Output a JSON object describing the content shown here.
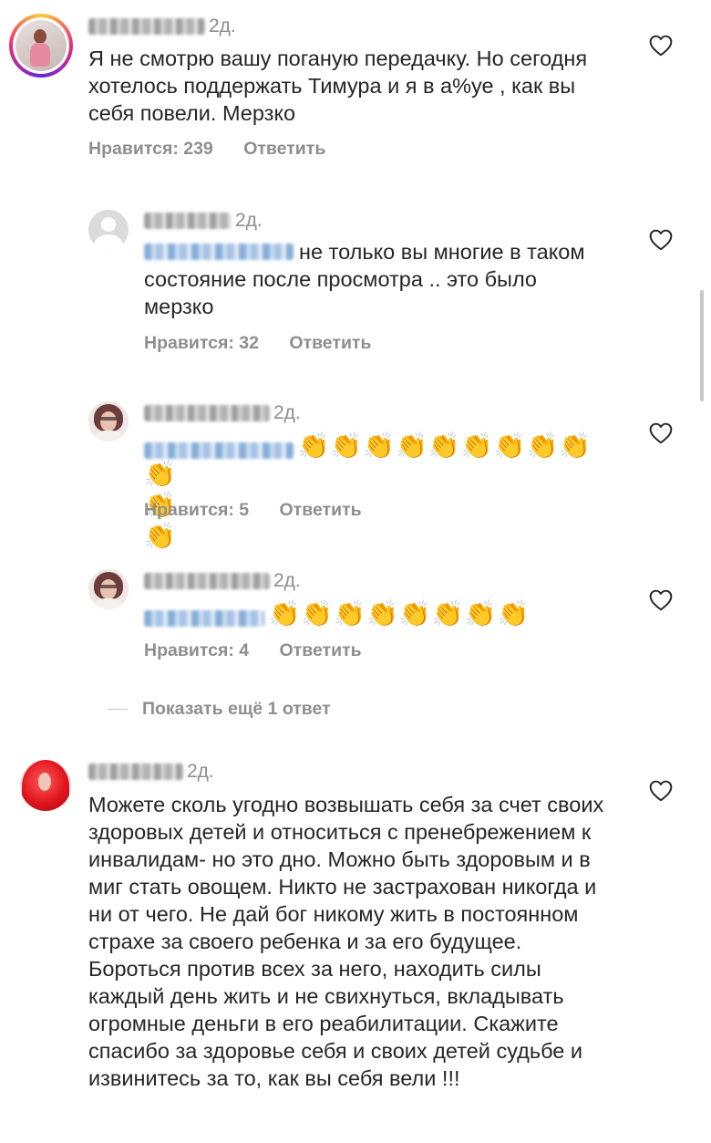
{
  "comments": [
    {
      "time": "2д.",
      "text": "Я не смотрю вашу поганую передачку.  Но сегодня хотелось поддержать Тимура и я в а%уе , как вы себя повели. Мерзко",
      "likes_label": "Нравится: 239",
      "reply_label": "Ответить"
    },
    {
      "time": "2д.",
      "text": "не только вы многие в таком состояние после просмотра .. это было мерзко",
      "likes_label": "Нравится: 32",
      "reply_label": "Ответить"
    },
    {
      "time": "2д.",
      "claps_line1": "👏👏👏👏👏👏👏👏👏",
      "claps_line2": "👏👏👏",
      "likes_label": "Нравится: 5",
      "reply_label": "Ответить"
    },
    {
      "time": "2д.",
      "claps_line1": "👏👏👏👏👏👏👏👏",
      "likes_label": "Нравится: 4",
      "reply_label": "Ответить"
    },
    {
      "time": "2д.",
      "text": "Можете сколь угодно возвышать себя за счет своих здоровых детей и относиться  с пренебрежением к инвалидам- но это дно. Можно быть здоровым и в миг стать овощем. Никто не застрахован никогда и ни от чего. Не дай бог никому жить в постоянном страхе за своего ребенка и за его будущее. Бороться против всех за него, находить силы каждый день жить и не свихнуться, вкладывать огромные деньги в его реабилитации. Скажите спасибо за здоровье себя и своих детей судьбе и извинитесь за то, как вы себя вели !!!"
    }
  ],
  "show_more_label": "Показать ещё 1 ответ",
  "icons": {
    "like": "heart-outline-icon",
    "avatar_placeholder": "default-user-icon"
  },
  "colors": {
    "text": "#262626",
    "secondary": "#8e8e8e",
    "story_ring": [
      "#f9ce34",
      "#ee2a7b",
      "#6228d7"
    ]
  }
}
